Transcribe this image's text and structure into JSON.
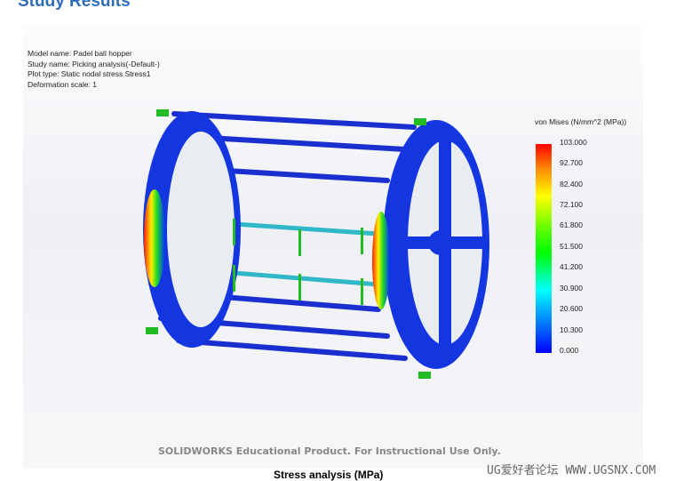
{
  "heading": "Study Results",
  "info": [
    "Model name: Padel ball hopper",
    "Study name: Picking analysis(-Default-)",
    "Plot type: Static nodal stress Stress1",
    "Deformation scale: 1"
  ],
  "legend": {
    "title": "von Mises (N/mm^2 (MPa))",
    "ticks": [
      "103.000",
      "92.700",
      "82.400",
      "72.100",
      "61.800",
      "51.500",
      "41.200",
      "30.900",
      "20.600",
      "10.300",
      "0.000"
    ],
    "max": 103.0,
    "min": 0.0
  },
  "watermark": "SOLIDWORKS Educational Product. For Instructional Use Only.",
  "caption": "Stress analysis (MPa)",
  "site_watermark": "UG爱好者论坛 WWW.UGSNX.COM",
  "colors": {
    "heading": "#2e6db5",
    "low_stress": "#0000ff",
    "high_stress": "#ff0000",
    "fixture": "#22bb22"
  }
}
